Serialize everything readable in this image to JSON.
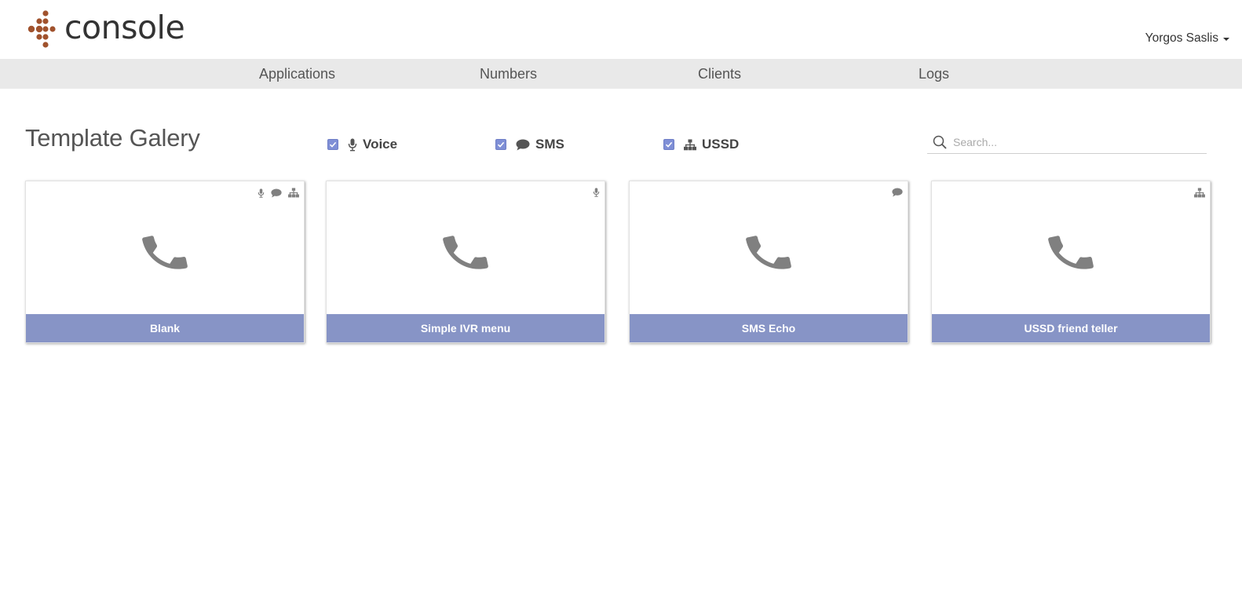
{
  "app": {
    "logo_text": "console",
    "brand_color": "#a0522d"
  },
  "user": {
    "name": "Yorgos Saslis"
  },
  "nav": {
    "items": [
      {
        "label": "Applications"
      },
      {
        "label": "Numbers"
      },
      {
        "label": "Clients"
      },
      {
        "label": "Logs"
      }
    ]
  },
  "page": {
    "title": "Template Galery"
  },
  "filters": [
    {
      "label": "Voice",
      "checked": true,
      "icon": "microphone-icon"
    },
    {
      "label": "SMS",
      "checked": true,
      "icon": "chat-bubble-icon"
    },
    {
      "label": "USSD",
      "checked": true,
      "icon": "sitemap-icon"
    }
  ],
  "search": {
    "placeholder": "Search...",
    "value": ""
  },
  "templates": [
    {
      "name": "Blank",
      "tags": [
        "microphone-icon",
        "chat-bubble-icon",
        "sitemap-icon"
      ]
    },
    {
      "name": "Simple IVR menu",
      "tags": [
        "microphone-icon"
      ]
    },
    {
      "name": "SMS Echo",
      "tags": [
        "chat-bubble-icon"
      ]
    },
    {
      "name": "USSD friend teller",
      "tags": [
        "sitemap-icon"
      ]
    }
  ],
  "colors": {
    "accent": "#8794c6",
    "checkbox": "#7f8fd6",
    "nav_bg": "#e9e9e9",
    "icon_gray": "#808080"
  }
}
